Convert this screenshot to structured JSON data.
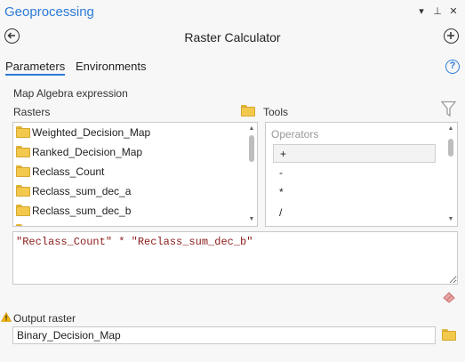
{
  "window": {
    "title": "Geoprocessing",
    "menu_glyph": "▾",
    "pin_glyph": "⊥",
    "close_glyph": "✕"
  },
  "navbar": {
    "heading": "Raster Calculator"
  },
  "tabs": [
    {
      "label": "Parameters",
      "active": true
    },
    {
      "label": "Environments",
      "active": false
    }
  ],
  "help": {
    "glyph": "?"
  },
  "section": {
    "map_algebra_label": "Map Algebra expression",
    "rasters_label": "Rasters",
    "tools_label": "Tools"
  },
  "rasters": {
    "items": [
      "Weighted_Decision_Map",
      "Ranked_Decision_Map",
      "Reclass_Count",
      "Reclass_sum_dec_a",
      "Reclass_sum_dec_b",
      "C"
    ]
  },
  "tools": {
    "category": "Operators",
    "items": [
      "+",
      "-",
      "*",
      "/"
    ]
  },
  "expression": {
    "value": "\"Reclass_Count\" * \"Reclass_sum_dec_b\""
  },
  "output": {
    "label": "Output raster",
    "value": "Binary_Decision_Map"
  },
  "colors": {
    "accent": "#2b7bd8",
    "expression_text": "#8b1a1a",
    "folder": "#f2c94c"
  }
}
